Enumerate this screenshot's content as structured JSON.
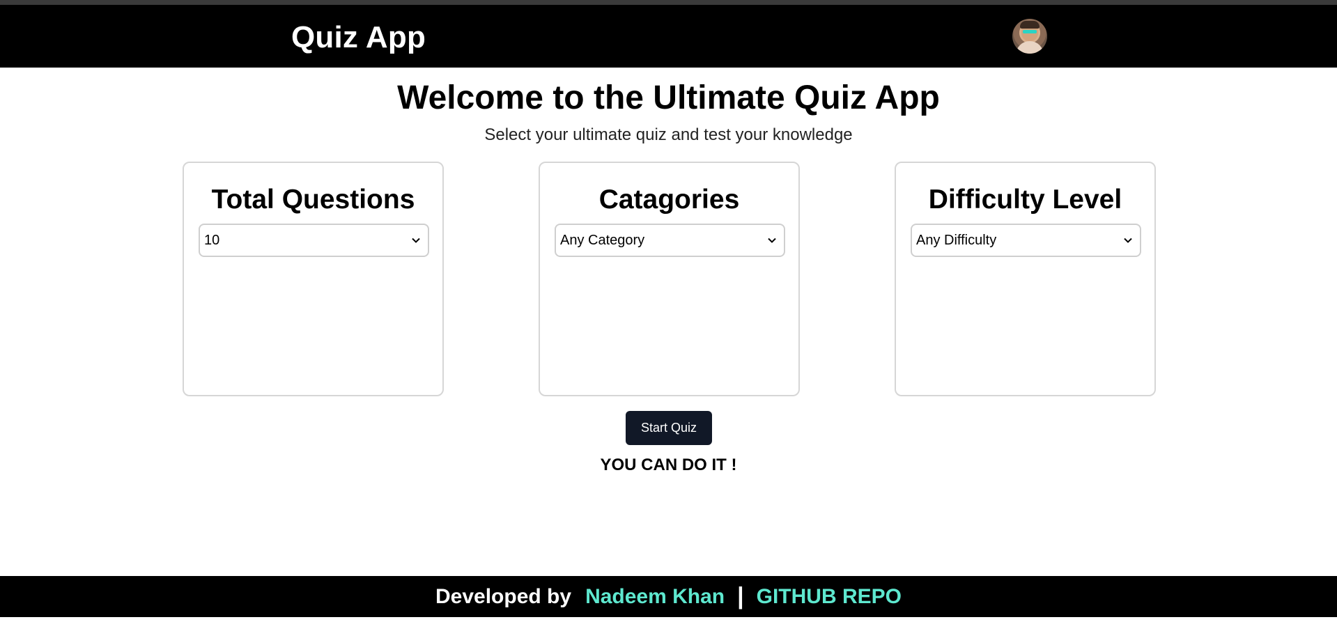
{
  "navbar": {
    "brand": "Quiz App",
    "avatar_icon": "user-avatar-icon"
  },
  "hero": {
    "title": "Welcome to the Ultimate Quiz App",
    "subtitle": "Select your ultimate quiz and test your knowledge"
  },
  "cards": [
    {
      "title": "Total Questions",
      "selected": "10"
    },
    {
      "title": "Catagories",
      "selected": "Any Category"
    },
    {
      "title": "Difficulty Level",
      "selected": "Any Difficulty"
    }
  ],
  "start_button": "Start Quiz",
  "motto": "YOU CAN DO IT !",
  "footer": {
    "developed_by": "Developed by",
    "author_link": "Nadeem Khan",
    "separator": "|",
    "repo_link": "GITHUB REPO"
  },
  "colors": {
    "navbar_bg": "#000000",
    "button_bg": "#111827",
    "link_accent": "#5ee8cf"
  }
}
